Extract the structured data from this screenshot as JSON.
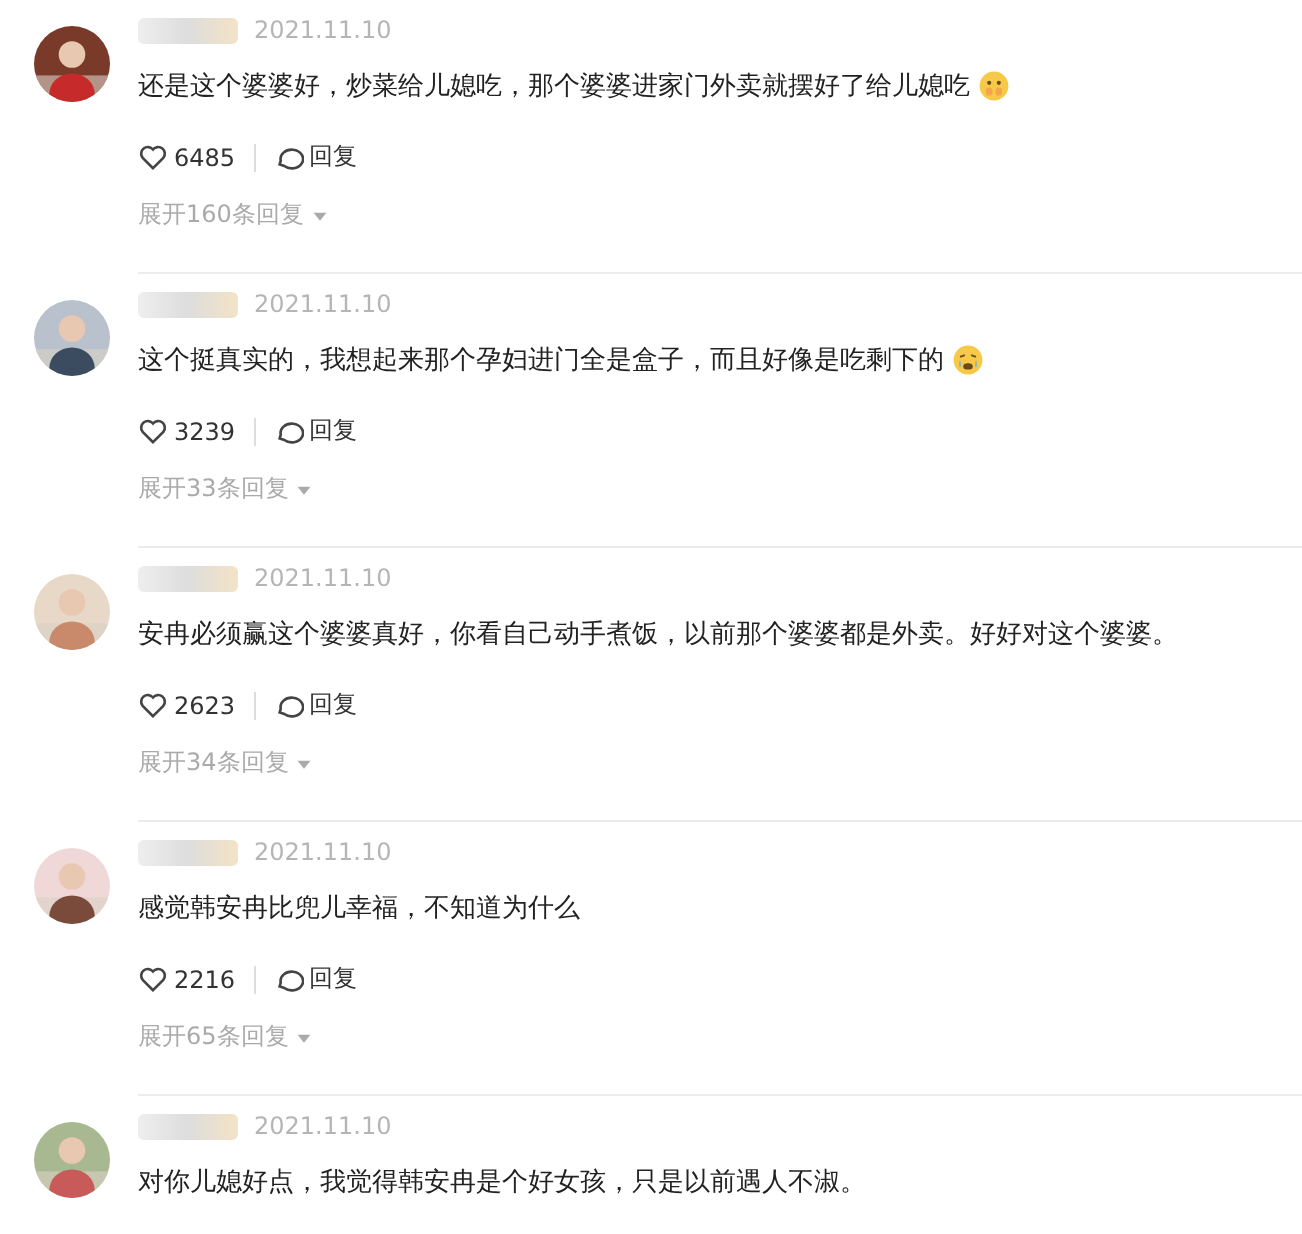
{
  "comments": [
    {
      "date": "2021.11.10",
      "text": "还是这个婆婆好，炒菜给儿媳吃，那个婆婆进家门外卖就摆好了给儿媳吃",
      "emoji": {
        "kind": "shy"
      },
      "likes": "6485",
      "reply": "回复",
      "expand": "展开160条回复"
    },
    {
      "date": "2021.11.10",
      "text": "这个挺真实的，我想起来那个孕妇进门全是盒子，而且好像是吃剩下的",
      "emoji": {
        "kind": "crying"
      },
      "likes": "3239",
      "reply": "回复",
      "expand": "展开33条回复"
    },
    {
      "date": "2021.11.10",
      "text": "安冉必须赢这个婆婆真好，你看自己动手煮饭，以前那个婆婆都是外卖。好好对这个婆婆。",
      "likes": "2623",
      "reply": "回复",
      "expand": "展开34条回复"
    },
    {
      "date": "2021.11.10",
      "text": "感觉韩安冉比兜儿幸福，不知道为什么",
      "likes": "2216",
      "reply": "回复",
      "expand": "展开65条回复"
    },
    {
      "date": "2021.11.10",
      "text": "对你儿媳好点，我觉得韩安冉是个好女孩，只是以前遇人不淑。"
    }
  ]
}
